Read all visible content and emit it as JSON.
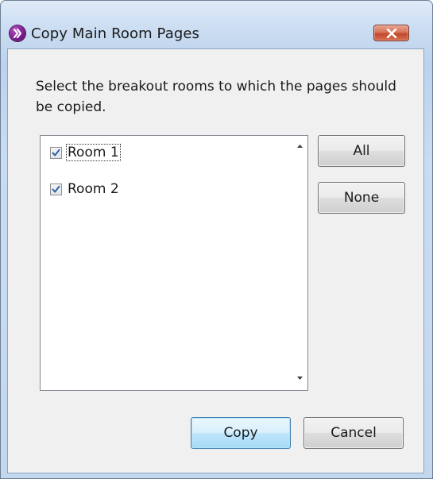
{
  "window": {
    "title": "Copy Main Room Pages",
    "app_icon": "purple-chevron-icon",
    "close_icon": "close-icon"
  },
  "prompt": "Select the breakout rooms to which the pages should be copied.",
  "rooms": [
    {
      "label": "Room 1",
      "checked": true,
      "focused": true
    },
    {
      "label": "Room 2",
      "checked": true,
      "focused": false
    }
  ],
  "side_buttons": {
    "all_label": "All",
    "none_label": "None"
  },
  "footer": {
    "copy_label": "Copy",
    "cancel_label": "Cancel"
  },
  "colors": {
    "title_bar": "#c8dbf1",
    "close_button": "#c94f35",
    "app_icon": "#7a1f8c",
    "default_button": "#bee6fd"
  }
}
